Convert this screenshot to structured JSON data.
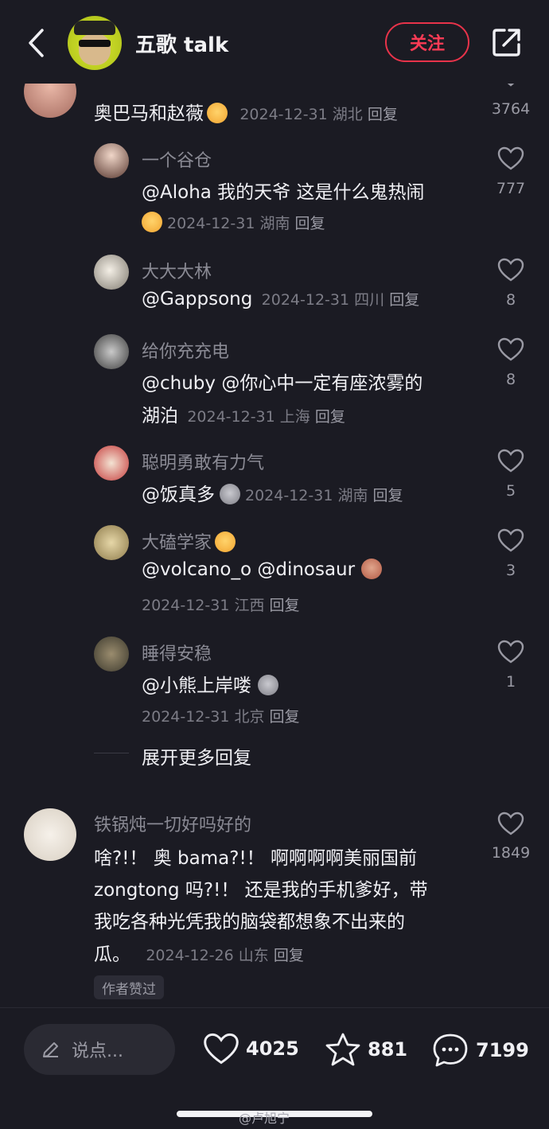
{
  "header": {
    "title": "五歌 talk",
    "follow_label": "关注"
  },
  "top_comment": {
    "text": "奥巴马和赵薇",
    "date": "2024-12-31",
    "location": "湖北",
    "reply": "回复",
    "likes": "3764"
  },
  "replies": [
    {
      "name": "一个谷仓",
      "text_line1": "@Aloha 我的天爷 这是什么鬼热闹",
      "date": "2024-12-31",
      "location": "湖南",
      "reply": "回复",
      "likes": "777"
    },
    {
      "name": "大大大林",
      "text_line1": "@Gappsong",
      "date": "2024-12-31",
      "location": "四川",
      "reply": "回复",
      "likes": "8"
    },
    {
      "name": "给你充充电",
      "text_line1": "@chuby @你心中一定有座浓雾的",
      "text_line2": "湖泊",
      "date": "2024-12-31",
      "location": "上海",
      "reply": "回复",
      "likes": "8"
    },
    {
      "name": "聪明勇敢有力气",
      "text_line1": "@饭真多",
      "date": "2024-12-31",
      "location": "湖南",
      "reply": "回复",
      "likes": "5"
    },
    {
      "name": "大磕学家",
      "text_line1": "@volcano_o @dinosaur",
      "date": "2024-12-31",
      "location": "江西",
      "reply": "回复",
      "likes": "3"
    },
    {
      "name": "睡得安稳",
      "text_line1": "@小熊上岸喽",
      "date": "2024-12-31",
      "location": "北京",
      "reply": "回复",
      "likes": "1"
    }
  ],
  "expand_more": "展开更多回复",
  "second_comment": {
    "name": "铁锅炖一切好吗好的",
    "line1": "啥?!！ 奥 bama?!！ 啊啊啊啊美丽国前",
    "line2": "zongtong 吗?!！ 还是我的手机爹好，带",
    "line3": "我吃各种光凭我的脑袋都想象不出来的",
    "line4": "瓜。",
    "date": "2024-12-26",
    "location": "山东",
    "reply": "回复",
    "likes": "1849",
    "tag": "作者赞过"
  },
  "bottom_bar": {
    "input_placeholder": "说点...",
    "likes": "4025",
    "favorites": "881",
    "comments": "7199"
  },
  "watermark": "@卢旭宁"
}
